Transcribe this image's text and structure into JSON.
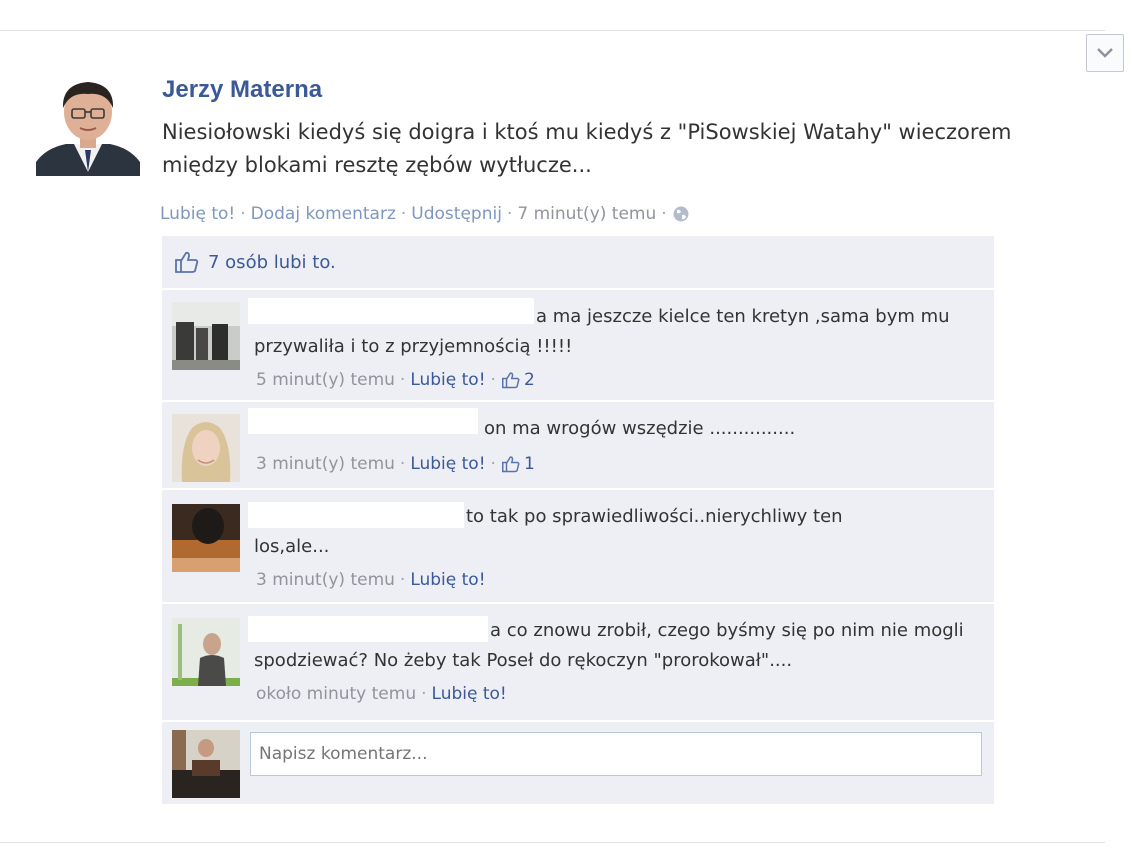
{
  "post": {
    "author": "Jerzy Materna",
    "text": "Niesiołowski kiedyś się doigra i ktoś mu kiedyś z \"PiSowskiej Watahy\" wieczorem między blokami resztę zębów wytłucze...",
    "actions": {
      "like": "Lubię to!",
      "comment": "Dodaj komentarz",
      "share": "Udostępnij",
      "time": "7 minut(y) temu",
      "sep": "·"
    }
  },
  "likes_summary": "7 osób lubi to.",
  "comments": [
    {
      "text": "a ma jeszcze kielce ten kretyn ,sama bym mu przywaliła i to z przyjemnością !!!!!",
      "time": "5 minut(y) temu",
      "like": "Lubię to!",
      "like_count": "2"
    },
    {
      "text": "on ma wrogów wszędzie ...............",
      "time": "3 minut(y) temu",
      "like": "Lubię to!",
      "like_count": "1"
    },
    {
      "text": "to tak po sprawiedliwości..nierychliwy ten los,ale...",
      "time": "3 minut(y) temu",
      "like": "Lubię to!",
      "like_count": ""
    },
    {
      "text": "a co znowu zrobił, czego byśmy się po nim nie mogli spodziewać? No żeby tak Poseł do rękoczyn \"prorokował\"....",
      "time": "około minuty temu",
      "like": "Lubię to!",
      "like_count": ""
    }
  ],
  "write_comment": {
    "placeholder": "Napisz komentarz..."
  },
  "colors": {
    "link": "#3b5998",
    "meta": "#90949c",
    "feedback_bg": "#edeff4"
  },
  "icons": [
    "chevron-down-icon",
    "thumbs-up-icon",
    "globe-icon"
  ]
}
